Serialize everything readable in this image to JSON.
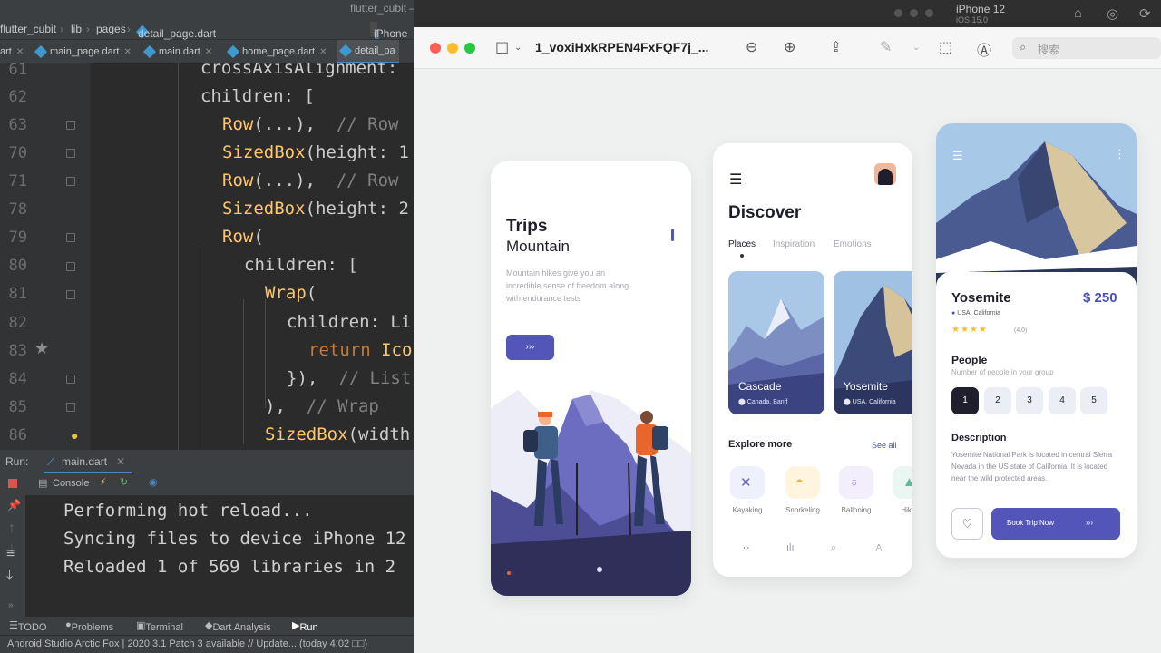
{
  "ide": {
    "window_title": "flutter_cubit – detail_page.dart",
    "breadcrumb": [
      "flutter_cubit",
      "lib",
      "pages",
      "detail_page.dart"
    ],
    "device_chip": "iPhone",
    "tabs": [
      "art",
      "main_page.dart",
      "main.dart",
      "home_page.dart",
      "detail_pa"
    ],
    "line_numbers": [
      "61",
      "62",
      "63",
      "70",
      "71",
      "78",
      "79",
      "80",
      "81",
      "82",
      "83",
      "84",
      "85",
      "86"
    ],
    "code": {
      "l61": "crossAxisAlignment:",
      "l62": "children: [",
      "l63_fn": "Row",
      "l63_rest": "(...),",
      "l63_cm": "// Row",
      "l70_fn": "SizedBox",
      "l70_rest": "(height: 1",
      "l71_fn": "Row",
      "l71_rest": "(...),",
      "l71_cm": "// Row",
      "l78_fn": "SizedBox",
      "l78_rest": "(height: 2",
      "l79_fn": "Row",
      "l79_rest": "(",
      "l80": "children: [",
      "l81_fn": "Wrap",
      "l81_rest": "(",
      "l82": "children: Li",
      "l83_kw": "return",
      "l83_rest": "Ico",
      "l84": "}),",
      "l84_cm": "// List",
      "l85": "),",
      "l85_cm": "// Wrap",
      "l86_fn": "SizedBox",
      "l86_rest": "(width"
    },
    "run": {
      "label": "Run:",
      "config": "main.dart",
      "console_tab": "Console",
      "output": [
        "Performing hot reload...",
        "Syncing files to device iPhone 12",
        "Reloaded 1 of 569 libraries in 2"
      ]
    },
    "bottom_tabs": [
      "TODO",
      "Problems",
      "Terminal",
      "Dart Analysis",
      "Run"
    ],
    "status": "Android Studio Arctic Fox | 2020.3.1 Patch 3 available // Update... (today 4:02 □□)"
  },
  "simulator": {
    "device": "iPhone 12",
    "os": "iOS 15.0"
  },
  "preview": {
    "title": "1_voxiHxkRPEN4FxFQF7j_...",
    "search_placeholder": "搜索",
    "colors": {
      "accent": "#5455b9",
      "star": "#f4c02a"
    }
  },
  "phone1": {
    "title": "Trips",
    "subtitle": "Mountain",
    "description": "Mountain hikes give you an incredible sense of freedom along with endurance tests",
    "cta": "›››"
  },
  "phone2": {
    "title": "Discover",
    "tabs": [
      "Places",
      "Inspiration",
      "Emotions"
    ],
    "places": [
      {
        "name": "Cascade",
        "location": "Canada, Banff"
      },
      {
        "name": "Yosemite",
        "location": "USA, California"
      }
    ],
    "explore": "Explore more",
    "see_all": "See all",
    "activities": [
      "Kayaking",
      "Snorkeling",
      "Balloning",
      "Hiki"
    ]
  },
  "phone3": {
    "name": "Yosemite",
    "price": "$ 250",
    "location": "USA, California",
    "stars": "★★★★",
    "rating": "(4.0)",
    "people_title": "People",
    "people_sub": "Number of people in your group",
    "numbers": [
      "1",
      "2",
      "3",
      "4",
      "5"
    ],
    "desc_title": "Description",
    "desc_text": "Yosemite National Park is located in central Sierra Nevada in the US state of California. It is located near the wild protected areas.",
    "book": "Book Trip Now",
    "book_arrows": "›››"
  }
}
